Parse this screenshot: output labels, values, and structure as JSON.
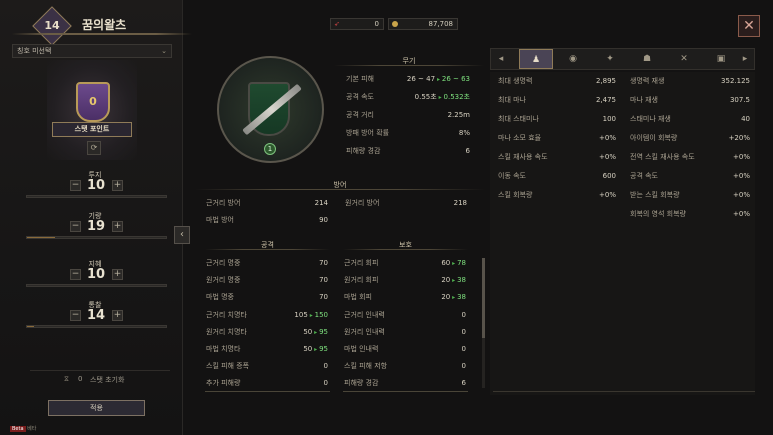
{
  "character": {
    "level": "14",
    "name": "꿈의왈츠"
  },
  "title_select": {
    "value": "칭호 미선택",
    "chevron_icon": "chevron-down-icon"
  },
  "stat_points": {
    "value": "0",
    "button_label": "스탯 포인트"
  },
  "stats": [
    {
      "label": "투지",
      "value": "10",
      "progress": 0.0
    },
    {
      "label": "기량",
      "value": "19",
      "progress": 0.2
    },
    {
      "label": "지혜",
      "value": "10",
      "progress": 0.0
    },
    {
      "label": "통찰",
      "value": "14",
      "progress": 0.05
    }
  ],
  "stat_reset": {
    "count": "0",
    "label": "스탯 초기화"
  },
  "apply_label": "적용",
  "beta": {
    "tag": "Beta",
    "text": "베타"
  },
  "currency": {
    "first": "0",
    "second": "87,708"
  },
  "weapon": {
    "section_title": "무기",
    "level": "1",
    "rows": [
      {
        "label": "기본 피해",
        "base": "26 ~ 47",
        "bonus": "26 ~ 63"
      },
      {
        "label": "공격 속도",
        "base": "0.55초",
        "bonus": "0.532초"
      },
      {
        "label": "공격 거리",
        "base": "2.25m",
        "bonus": ""
      },
      {
        "label": "방패 방어 확률",
        "base": "8%",
        "bonus": ""
      },
      {
        "label": "피해량 경감",
        "base": "6",
        "bonus": ""
      }
    ]
  },
  "defense": {
    "section_title": "방어",
    "rows": [
      {
        "label": "근거리 방어",
        "value": "214"
      },
      {
        "label": "원거리 방어",
        "value": "218"
      },
      {
        "label": "마법 방어",
        "value": "90"
      }
    ]
  },
  "attack": {
    "section_title": "공격",
    "rows": [
      {
        "label": "근거리 명중",
        "base": "70",
        "bonus": ""
      },
      {
        "label": "원거리 명중",
        "base": "70",
        "bonus": ""
      },
      {
        "label": "마법 명중",
        "base": "70",
        "bonus": ""
      },
      {
        "label": "근거리 치명타",
        "base": "105",
        "bonus": "150"
      },
      {
        "label": "원거리 치명타",
        "base": "50",
        "bonus": "95"
      },
      {
        "label": "마법 치명타",
        "base": "50",
        "bonus": "95"
      },
      {
        "label": "스킬 피해 증폭",
        "base": "0",
        "bonus": ""
      },
      {
        "label": "추가 피해량",
        "base": "0",
        "bonus": ""
      }
    ]
  },
  "protection": {
    "section_title": "보호",
    "rows": [
      {
        "label": "근거리 회피",
        "base": "60",
        "bonus": "78"
      },
      {
        "label": "원거리 회피",
        "base": "20",
        "bonus": "38"
      },
      {
        "label": "마법 회피",
        "base": "20",
        "bonus": "38"
      },
      {
        "label": "근거리 인내력",
        "base": "0",
        "bonus": ""
      },
      {
        "label": "원거리 인내력",
        "base": "0",
        "bonus": ""
      },
      {
        "label": "마법 인내력",
        "base": "0",
        "bonus": ""
      },
      {
        "label": "스킬 피해 저항",
        "base": "0",
        "bonus": ""
      },
      {
        "label": "피해량 경감",
        "base": "6",
        "bonus": ""
      }
    ]
  },
  "right_tabs": [
    "person-icon",
    "eye-icon",
    "beast-icon",
    "demon-icon",
    "crossed-swords-icon",
    "cube-icon"
  ],
  "right_col1": [
    {
      "label": "최대 생명력",
      "value": "2,895"
    },
    {
      "label": "최대 마나",
      "value": "2,475"
    },
    {
      "label": "최대 스태미나",
      "value": "100"
    },
    {
      "label": "마나 소모 효율",
      "value": "+0%"
    },
    {
      "label": "스킬 재사용 속도",
      "value": "+0%"
    },
    {
      "label": "이동 속도",
      "value": "600"
    },
    {
      "label": "스킬 회복량",
      "value": "+0%"
    }
  ],
  "right_col2": [
    {
      "label": "생명력 재생",
      "value": "352.125"
    },
    {
      "label": "마나 재생",
      "value": "307.5"
    },
    {
      "label": "스태미나 재생",
      "value": "40"
    },
    {
      "label": "아이템이 회복량",
      "value": "+20%"
    },
    {
      "label": "전역 스킬 재사용 속도",
      "value": "+0%"
    },
    {
      "label": "공격 속도",
      "value": "+0%"
    },
    {
      "label": "받는 스킬 회복량",
      "value": "+0%"
    },
    {
      "label": "회복의 영석 회복량",
      "value": "+0%"
    }
  ],
  "colors": {
    "bonus_green": "#7ee07e",
    "accent_gold": "#8f7b58",
    "active_tab": "#4a4455"
  }
}
